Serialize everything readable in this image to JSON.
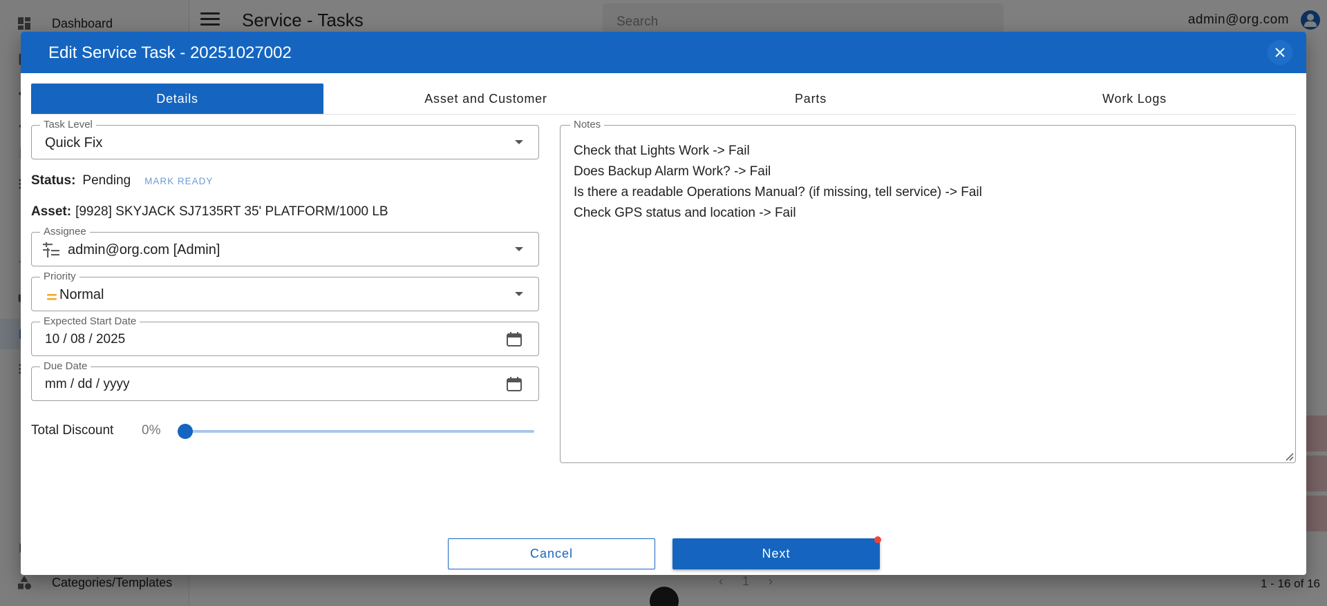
{
  "app": {
    "page_title": "Service - Tasks",
    "search_placeholder": "Search",
    "user_email": "admin@org.com",
    "sidebar": {
      "top_item": "Dashboard",
      "bottom_item": "Categories/Templates"
    },
    "pagination": {
      "page": "1",
      "range": "1 - 16 of 16"
    }
  },
  "dialog": {
    "title": "Edit Service Task - 20251027002",
    "tabs": [
      {
        "label": "Details",
        "active": true
      },
      {
        "label": "Asset and Customer",
        "active": false
      },
      {
        "label": "Parts",
        "active": false
      },
      {
        "label": "Work Logs",
        "active": false
      }
    ],
    "task_level": {
      "label": "Task Level",
      "value": "Quick Fix"
    },
    "status": {
      "key": "Status:",
      "value": "Pending",
      "action": "MARK READY"
    },
    "asset": {
      "key": "Asset:",
      "value": "[9928] SKYJACK SJ7135RT 35' PLATFORM/1000 LB"
    },
    "assignee": {
      "label": "Assignee",
      "value": "admin@org.com [Admin]"
    },
    "priority": {
      "label": "Priority",
      "value": "Normal",
      "icon_color": "#f5a623"
    },
    "expected_start_date": {
      "label": "Expected Start Date",
      "value": "10 / 08 / 2025"
    },
    "due_date": {
      "label": "Due Date",
      "value": "mm / dd / yyyy"
    },
    "total_discount": {
      "label": "Total Discount",
      "value": "0%",
      "fraction": 0
    },
    "notes": {
      "label": "Notes",
      "lines": [
        "Check that Lights Work -> Fail",
        "Does Backup Alarm Work? -> Fail",
        "Is there a readable Operations Manual? (if missing, tell service) -> Fail",
        "Check GPS status and location -> Fail"
      ]
    },
    "buttons": {
      "cancel": "Cancel",
      "next": "Next"
    }
  },
  "colors": {
    "primary": "#1565c0",
    "badge": "#f44336",
    "priority_normal": "#f5a623"
  }
}
